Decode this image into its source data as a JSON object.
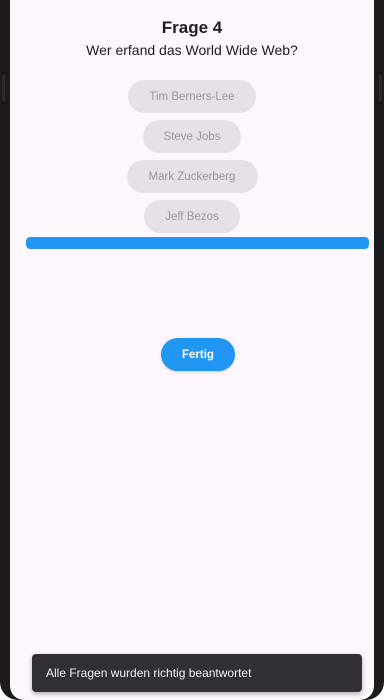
{
  "quiz": {
    "title": "Frage 4",
    "question": "Wer erfand das World Wide Web?",
    "answers": [
      {
        "label": "Tim Berners-Lee"
      },
      {
        "label": "Steve Jobs"
      },
      {
        "label": "Mark Zuckerberg"
      },
      {
        "label": "Jeff Bezos"
      }
    ],
    "progress": 1.0,
    "done_label": "Fertig"
  },
  "snackbar": {
    "message": "Alle Fragen wurden richtig beantwortet"
  },
  "colors": {
    "accent": "#2196f3",
    "background": "#fdf7fd",
    "answer_bg": "#e4e0e5",
    "snackbar_bg": "#323034"
  }
}
